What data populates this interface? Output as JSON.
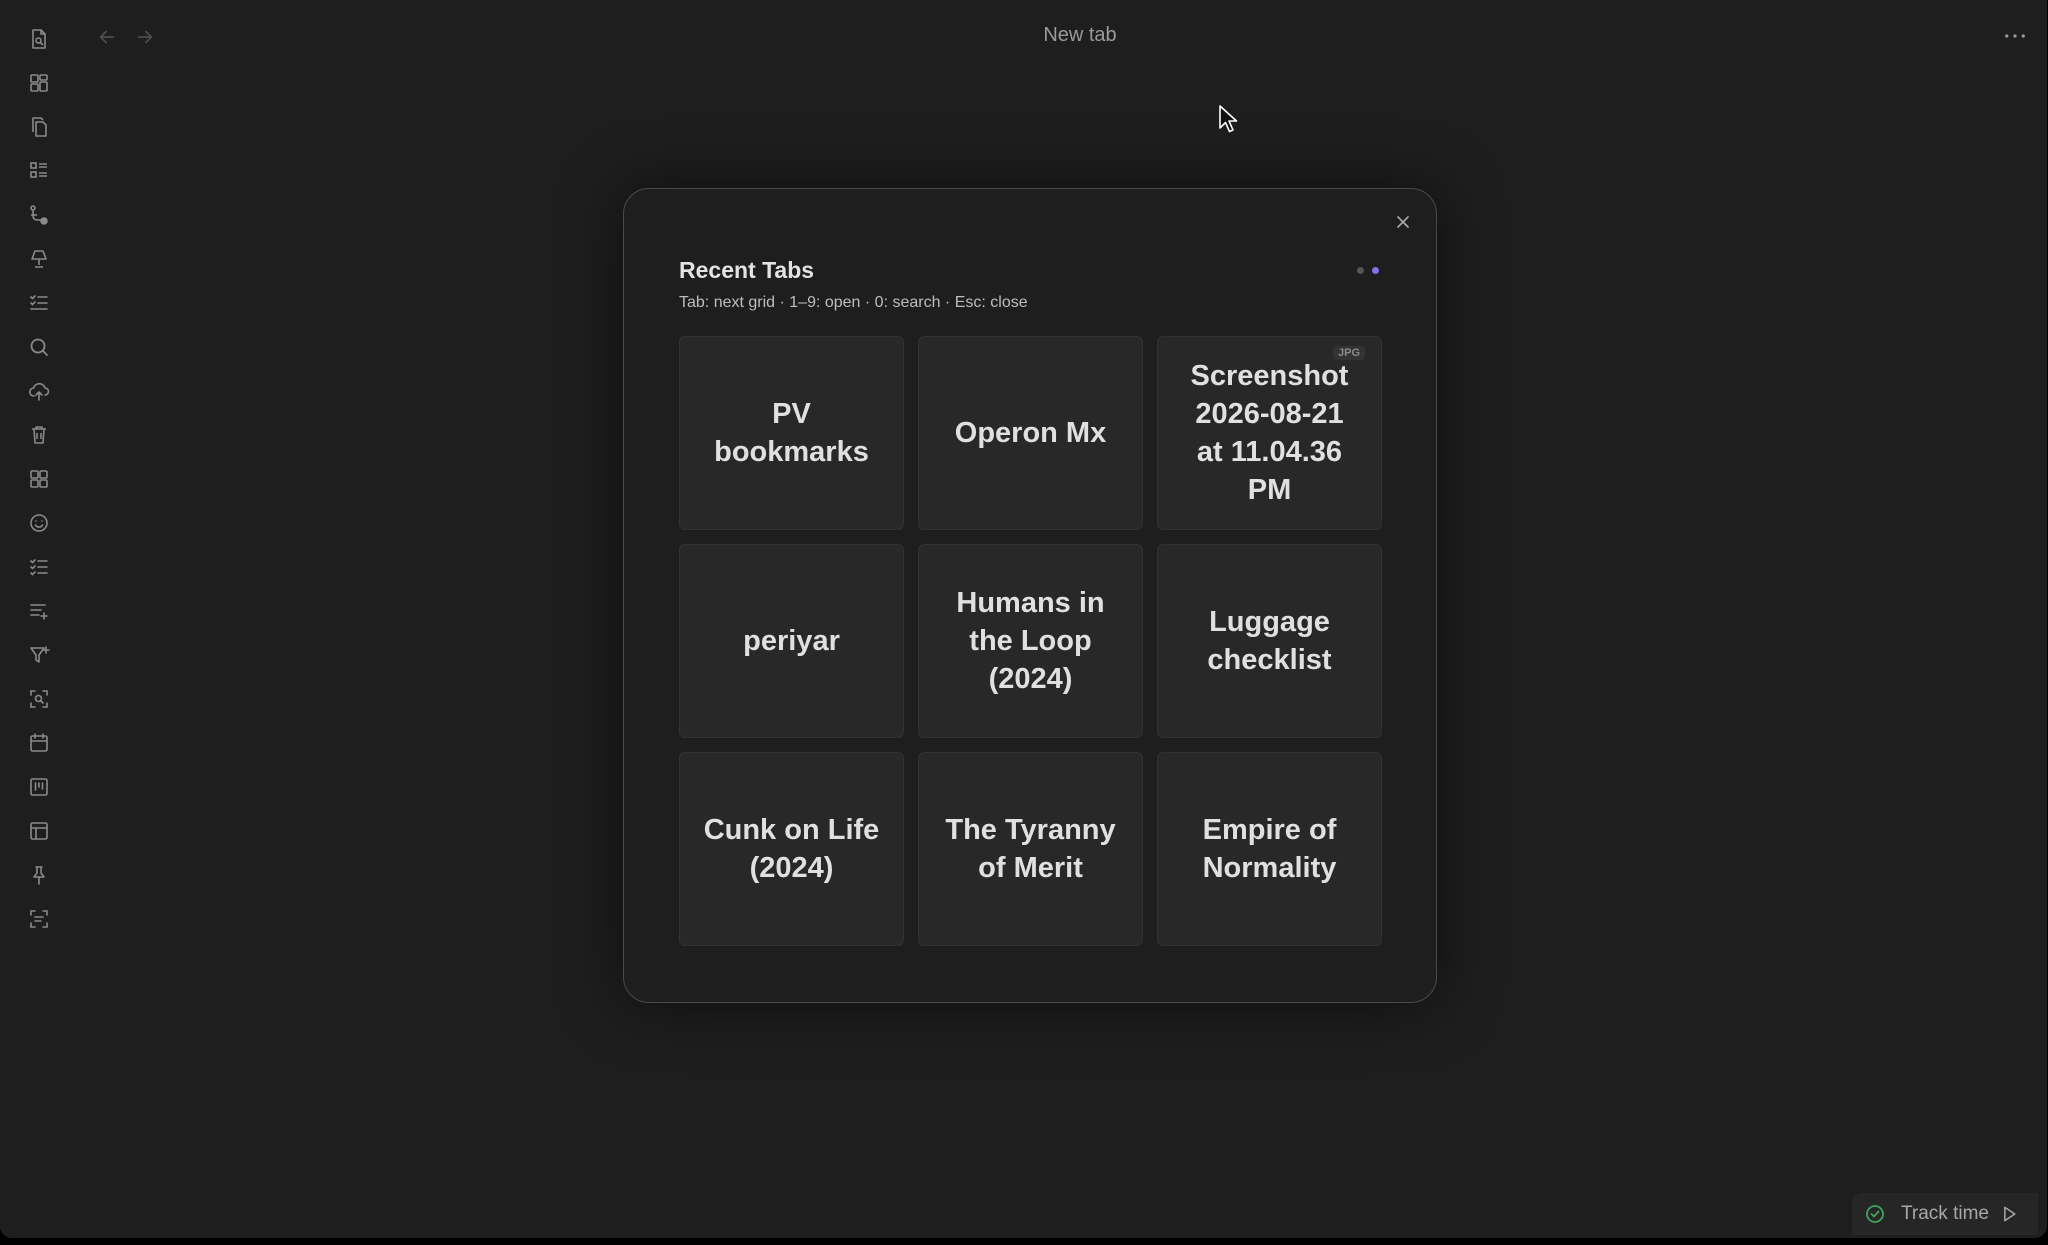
{
  "header": {
    "tab_title": "New tab",
    "back_icon": "arrow-left-icon",
    "forward_icon": "arrow-right-icon",
    "more_icon": "more-horizontal-icon"
  },
  "ribbon": {
    "icons": [
      "file-search-icon",
      "dashboard-icon",
      "copy-files-icon",
      "list-grid-icon",
      "graph-nodes-icon",
      "lamp-icon",
      "checklist-icon",
      "search-icon",
      "cloud-upload-icon",
      "trash-icon",
      "apps-grid-icon",
      "smiley-icon",
      "task-list-icon",
      "list-plus-icon",
      "filter-plus-icon",
      "scan-search-icon",
      "calendar-icon",
      "kanban-icon",
      "table-icon",
      "pin-icon",
      "scan-text-icon"
    ]
  },
  "modal": {
    "title": "Recent Tabs",
    "hint": "Tab: next grid · 1–9: open · 0: search · Esc: close",
    "close_icon": "close-icon",
    "page_dots": [
      {
        "active": false,
        "color": "#555555"
      },
      {
        "active": true,
        "color": "#8b6cf0"
      }
    ],
    "tiles": [
      {
        "label": "PV bookmarks",
        "badge": ""
      },
      {
        "label": "Operon Mx",
        "badge": ""
      },
      {
        "label": "Screenshot 2026-08-21 at 11.04.36 PM",
        "badge": "JPG"
      },
      {
        "label": "periyar",
        "badge": ""
      },
      {
        "label": "Humans in the Loop (2024)",
        "badge": ""
      },
      {
        "label": "Luggage checklist",
        "badge": ""
      },
      {
        "label": "Cunk on Life (2024)",
        "badge": ""
      },
      {
        "label": "The Tyranny of Merit",
        "badge": ""
      },
      {
        "label": "Empire of Normality",
        "badge": ""
      }
    ]
  },
  "status_bar": {
    "label": "Track time",
    "check_icon": "check-circle-icon",
    "play_icon": "play-icon",
    "check_color": "#3fa45b"
  },
  "colors": {
    "background": "#1e1e1e",
    "tile": "#282828",
    "accent": "#8b6cf0"
  }
}
